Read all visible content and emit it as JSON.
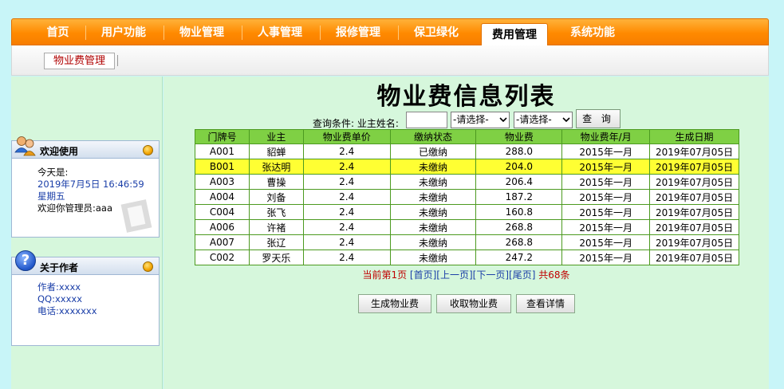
{
  "nav": {
    "items": [
      "首页",
      "用户功能",
      "物业管理",
      "人事管理",
      "报修管理",
      "保卫绿化",
      "费用管理",
      "系统功能"
    ],
    "active_index": 6
  },
  "subnav": {
    "tab": "物业费管理"
  },
  "welcome": {
    "title": "欢迎使用",
    "today_label": "今天是:",
    "datetime": "2019年7月5日  16:46:59",
    "weekday": "星期五",
    "greeting": "欢迎你管理员:aaa"
  },
  "about": {
    "title": "关于作者",
    "author": "作者:xxxx",
    "qq": "QQ:xxxxx",
    "phone": "电话:xxxxxxx"
  },
  "main": {
    "title": "物业费信息列表",
    "query_label": "查询条件: 业主姓名:",
    "owner_value": "",
    "select1": "-请选择-",
    "select2": "-请选择-",
    "query_button": "查 询"
  },
  "table": {
    "headers": [
      "门牌号",
      "业主",
      "物业费单价",
      "缴纳状态",
      "物业费",
      "物业费年/月",
      "生成日期"
    ],
    "rows": [
      [
        "A001",
        "貂蝉",
        "2.4",
        "已缴纳",
        "288.0",
        "2015年一月",
        "2019年07月05日"
      ],
      [
        "B001",
        "张达明",
        "2.4",
        "未缴纳",
        "204.0",
        "2015年一月",
        "2019年07月05日"
      ],
      [
        "A003",
        "曹操",
        "2.4",
        "未缴纳",
        "206.4",
        "2015年一月",
        "2019年07月05日"
      ],
      [
        "A004",
        "刘备",
        "2.4",
        "未缴纳",
        "187.2",
        "2015年一月",
        "2019年07月05日"
      ],
      [
        "C004",
        "张飞",
        "2.4",
        "未缴纳",
        "160.8",
        "2015年一月",
        "2019年07月05日"
      ],
      [
        "A006",
        "许褚",
        "2.4",
        "未缴纳",
        "268.8",
        "2015年一月",
        "2019年07月05日"
      ],
      [
        "A007",
        "张辽",
        "2.4",
        "未缴纳",
        "268.8",
        "2015年一月",
        "2019年07月05日"
      ],
      [
        "C002",
        "罗天乐",
        "2.4",
        "未缴纳",
        "247.2",
        "2015年一月",
        "2019年07月05日"
      ]
    ],
    "highlight_row": 1
  },
  "pager": {
    "current": "当前第1页",
    "first": "[首页]",
    "prev": "[上一页]",
    "next": "[下一页]",
    "last": "[尾页]",
    "total": "共68条"
  },
  "actions": {
    "generate": "生成物业费",
    "collect": "收取物业费",
    "detail": "查看详情"
  },
  "colors": {
    "nav_orange": "#ff8a00",
    "header_green": "#7fd044",
    "highlight_yellow": "#ffff33",
    "page_bg": "#c8f5f8",
    "panel_bg": "#d6f7dc"
  }
}
